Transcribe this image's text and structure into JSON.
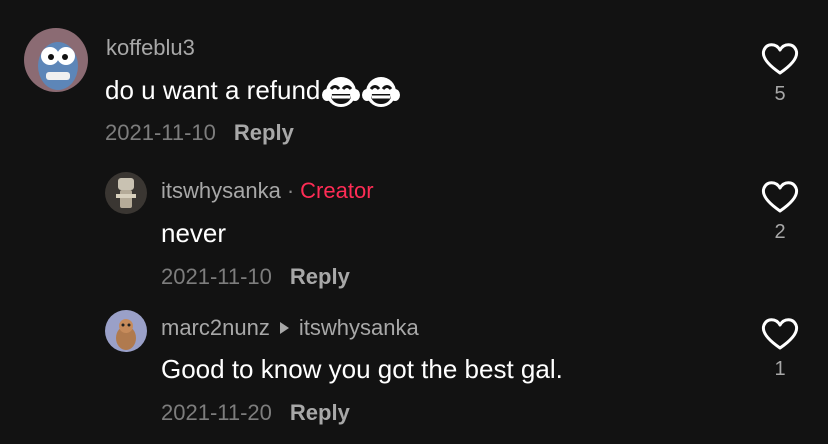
{
  "comments": [
    {
      "username": "koffeblu3",
      "text": "do u want a refund",
      "emoji": "face-with-tears-of-joy",
      "date": "2021-11-10",
      "reply_label": "Reply",
      "likes": "5"
    },
    {
      "username": "itswhysanka",
      "separator": "·",
      "badge": "Creator",
      "text": "never",
      "date": "2021-11-10",
      "reply_label": "Reply",
      "likes": "2"
    },
    {
      "username": "marc2nunz",
      "reply_to": "itswhysanka",
      "text": "Good to know you got the best gal.",
      "date": "2021-11-20",
      "reply_label": "Reply",
      "likes": "1"
    }
  ],
  "colors": {
    "background": "#121212",
    "creator_badge": "#fe2c55",
    "username": "#a8a8a8",
    "meta": "#7d7d7d"
  },
  "icons": [
    "heart-outline-icon",
    "face-with-tears-of-joy-emoji",
    "reply-arrow-icon"
  ]
}
